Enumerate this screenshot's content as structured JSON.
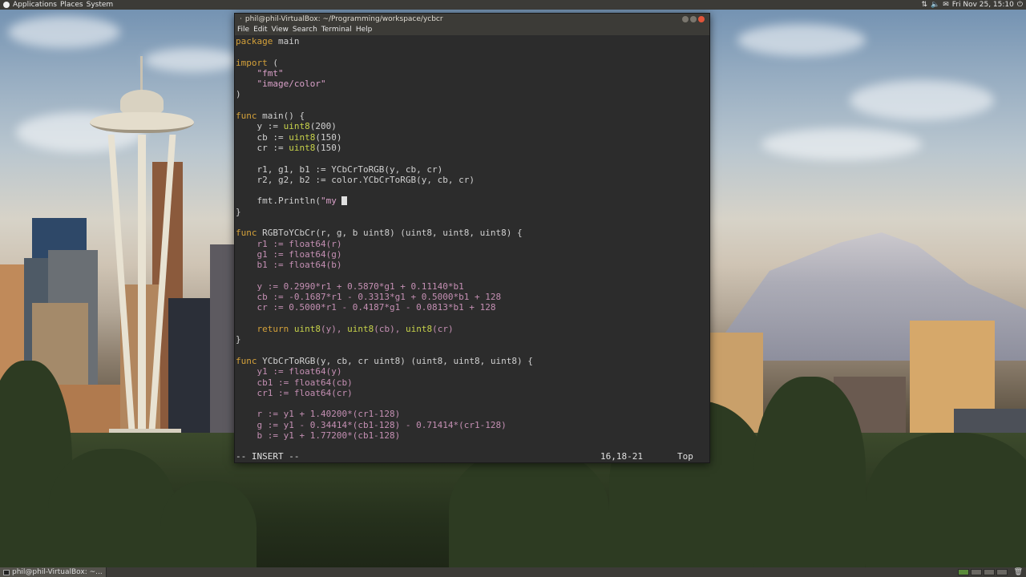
{
  "top_panel": {
    "menus": [
      "Applications",
      "Places",
      "System"
    ],
    "clock": "Fri Nov 25, 15:10"
  },
  "terminal": {
    "title": "phil@phil-VirtualBox: ~/Programming/workspace/ycbcr",
    "menu": [
      "File",
      "Edit",
      "View",
      "Search",
      "Terminal",
      "Help"
    ],
    "status": {
      "mode": "-- INSERT --",
      "position": "16,18-21",
      "scroll": "Top"
    }
  },
  "code": [
    "package main",
    "",
    "import (",
    "    \"fmt\"",
    "    \"image/color\"",
    ")",
    "",
    "func main() {",
    "    y := uint8(200)",
    "    cb := uint8(150)",
    "    cr := uint8(150)",
    "",
    "    r1, g1, b1 := YCbCrToRGB(y, cb, cr)",
    "    r2, g2, b2 := color.YCbCrToRGB(y, cb, cr)",
    "",
    "    fmt.Println(\"my ",
    "}",
    "",
    "func RGBToYCbCr(r, g, b uint8) (uint8, uint8, uint8) {",
    "    r1 := float64(r)",
    "    g1 := float64(g)",
    "    b1 := float64(b)",
    "",
    "    y := 0.2990*r1 + 0.5870*g1 + 0.11140*b1",
    "    cb := -0.1687*r1 - 0.3313*g1 + 0.5000*b1 + 128",
    "    cr := 0.5000*r1 - 0.4187*g1 - 0.0813*b1 + 128",
    "",
    "    return uint8(y), uint8(cb), uint8(cr)",
    "}",
    "",
    "func YCbCrToRGB(y, cb, cr uint8) (uint8, uint8, uint8) {",
    "    y1 := float64(y)",
    "    cb1 := float64(cb)",
    "    cr1 := float64(cr)",
    "",
    "    r := y1 + 1.40200*(cr1-128)",
    "    g := y1 - 0.34414*(cb1-128) - 0.71414*(cr1-128)",
    "    b := y1 + 1.77200*(cb1-128)"
  ],
  "bottom_panel": {
    "task_label": "phil@phil-VirtualBox: ~..."
  },
  "icons": {
    "network": "network-icon",
    "volume": "volume-icon",
    "terminal": "terminal-icon"
  }
}
